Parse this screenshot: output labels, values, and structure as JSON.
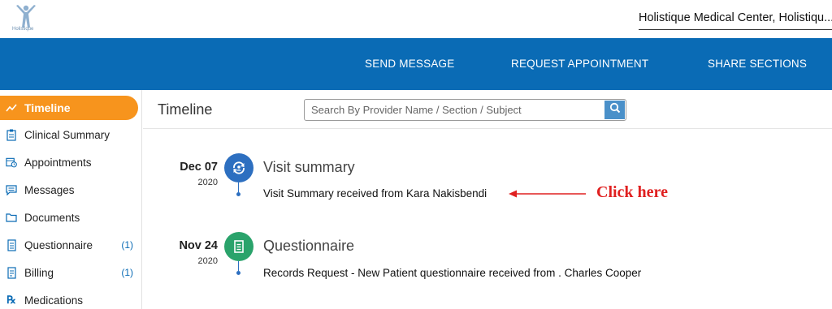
{
  "header": {
    "logo_text": "Holistique",
    "organization": "Holistique Medical Center, Holistiqu..."
  },
  "nav": {
    "send_message": "SEND MESSAGE",
    "request_appointment": "REQUEST APPOINTMENT",
    "share_sections": "SHARE SECTIONS"
  },
  "sidebar": {
    "items": [
      {
        "label": "Timeline",
        "icon": "trend-line-icon",
        "active": true
      },
      {
        "label": "Clinical Summary",
        "icon": "clipboard-icon"
      },
      {
        "label": "Appointments",
        "icon": "calendar-clock-icon"
      },
      {
        "label": "Messages",
        "icon": "message-icon"
      },
      {
        "label": "Documents",
        "icon": "folder-icon"
      },
      {
        "label": "Questionnaire",
        "icon": "form-icon",
        "count": "(1)"
      },
      {
        "label": "Billing",
        "icon": "invoice-icon",
        "count": "(1)"
      },
      {
        "label": "Medications",
        "icon": "rx-icon"
      }
    ]
  },
  "main": {
    "title": "Timeline",
    "search_placeholder": "Search By Provider Name / Section / Subject"
  },
  "timeline": [
    {
      "date": "Dec 07",
      "year": "2020",
      "title": "Visit summary",
      "description": "Visit Summary received from Kara Nakisbendi",
      "icon": "visit-summary-icon",
      "color": "#2d6fc0"
    },
    {
      "date": "Nov 24",
      "year": "2020",
      "title": "Questionnaire",
      "description": "Records Request - New Patient questionnaire received from . Charles Cooper",
      "icon": "questionnaire-icon",
      "color": "#2aa36b"
    }
  ],
  "annotation": {
    "text": "Click here",
    "color": "#e02020"
  },
  "colors": {
    "nav_blue": "#0a6bb5",
    "active_orange": "#f7941d",
    "search_button": "#4a90c9"
  }
}
